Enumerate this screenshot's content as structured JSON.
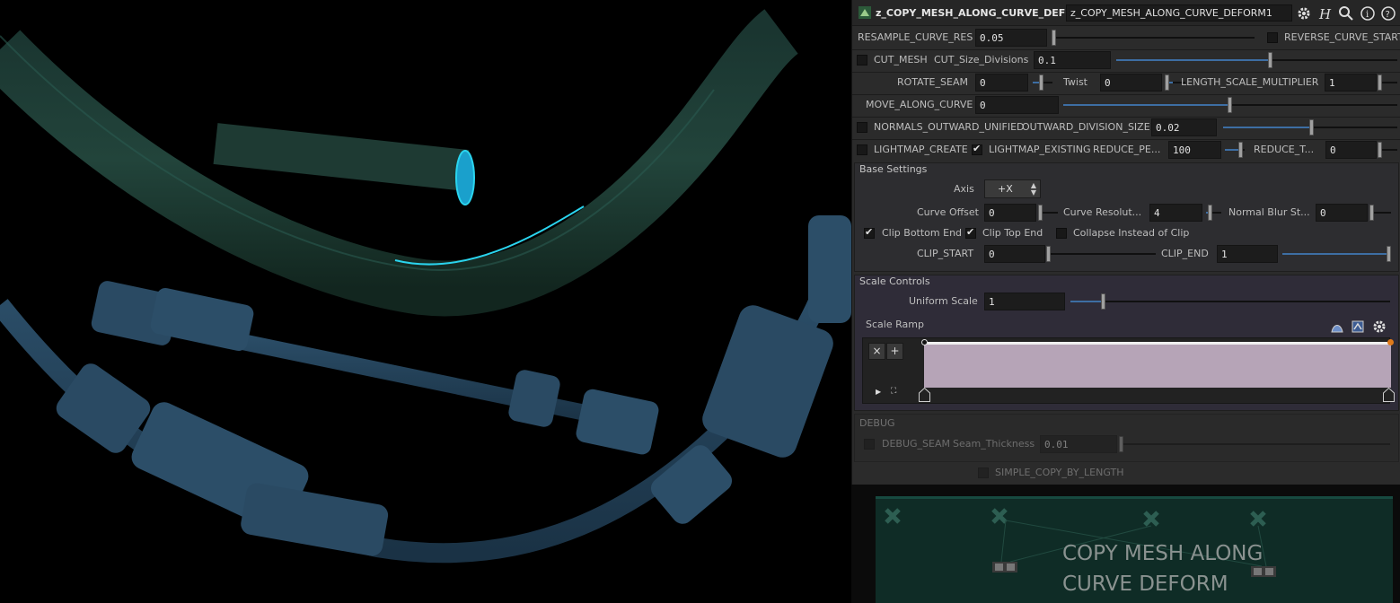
{
  "header": {
    "node_type": "z_COPY_MESH_ALONG_CURVE_DEFORM",
    "node_name": "z_COPY_MESH_ALONG_CURVE_DEFORM1",
    "icons": [
      "gear-icon",
      "help-h-icon",
      "search-icon",
      "info-icon",
      "help-icon"
    ]
  },
  "params": {
    "resample_label": "RESAMPLE_CURVE_RES",
    "resample_value": "0.05",
    "reverse_label": "REVERSE_CURVE_START",
    "cut_mesh_label": "CUT_MESH",
    "cut_size_label": "CUT_Size_Divisions",
    "cut_size_value": "0.1",
    "rotate_seam_label": "ROTATE_SEAM",
    "rotate_seam_value": "0",
    "twist_label": "Twist",
    "twist_value": "0",
    "length_scale_label": "LENGTH_SCALE_MULTIPLIER",
    "length_scale_value": "1",
    "move_along_label": "MOVE_ALONG_CURVE",
    "move_along_value": "0",
    "normals_label": "NORMALS_OUTWARD_UNIFIED",
    "outward_div_label": "OUTWARD_DIVISION_SIZE",
    "outward_div_value": "0.02",
    "lightmap_create_label": "LIGHTMAP_CREATE",
    "lightmap_existing_label": "LIGHTMAP_EXISTING",
    "reduce_pe_label": "REDUCE_PE...",
    "reduce_pe_value": "100",
    "reduce_t_label": "REDUCE_T...",
    "reduce_t_value": "0"
  },
  "base": {
    "title": "Base Settings",
    "axis_label": "Axis",
    "axis_value": "+X",
    "curve_offset_label": "Curve Offset",
    "curve_offset_value": "0",
    "curve_res_label": "Curve Resolut...",
    "curve_res_value": "4",
    "normal_blur_label": "Normal Blur St...",
    "normal_blur_value": "0",
    "clip_bottom_label": "Clip Bottom End",
    "clip_top_label": "Clip Top End",
    "collapse_label": "Collapse Instead of Clip",
    "clip_start_label": "CLIP_START",
    "clip_start_value": "0",
    "clip_end_label": "CLIP_END",
    "clip_end_value": "1"
  },
  "scale": {
    "title": "Scale Controls",
    "uniform_label": "Uniform Scale",
    "uniform_value": "1",
    "ramp_label": "Scale Ramp",
    "ramp_delete": "×",
    "ramp_add": "+"
  },
  "debug": {
    "title": "DEBUG",
    "debug_seam_label": "DEBUG_SEAM",
    "seam_thickness_label": "Seam_Thickness",
    "seam_thickness_value": "0.01",
    "simple_copy_label": "SIMPLE_COPY_BY_LENGTH"
  },
  "network": {
    "title_line1": "COPY MESH ALONG",
    "title_line2": "CURVE DEFORM"
  },
  "colors": {
    "accent": "#3d6ea3",
    "ramp_fill": "#b6a4b7",
    "tube_green": "#1c3a33",
    "tube_blue": "#2a4a63",
    "cyan_edge": "#21c8e6"
  }
}
